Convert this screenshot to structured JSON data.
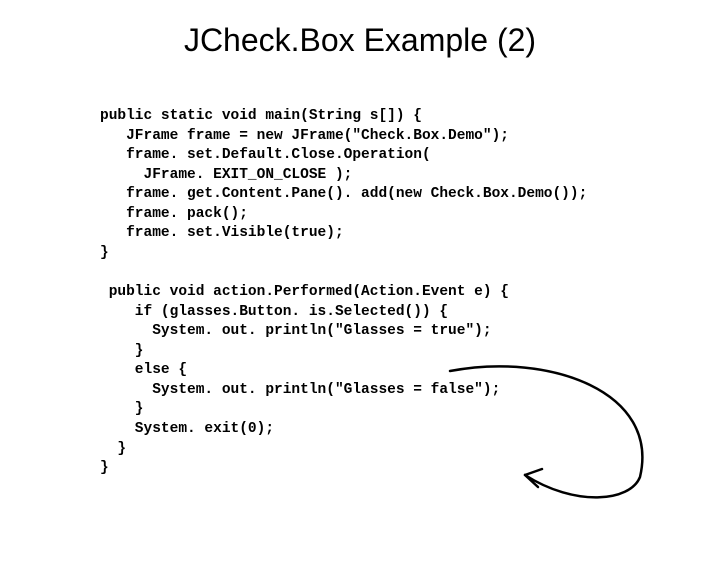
{
  "title": "JCheck.Box Example (2)",
  "code_lines": [
    "public static void main(String s[]) {",
    "   JFrame frame = new JFrame(\"Check.Box.Demo\");",
    "   frame. set.Default.Close.Operation(",
    "     JFrame. EXIT_ON_CLOSE );",
    "   frame. get.Content.Pane(). add(new Check.Box.Demo());",
    "   frame. pack();",
    "   frame. set.Visible(true);",
    "}",
    "",
    " public void action.Performed(Action.Event e) {",
    "    if (glasses.Button. is.Selected()) {",
    "      System. out. println(\"Glasses = true\");",
    "    }",
    "    else {",
    "      System. out. println(\"Glasses = false\");",
    "    }",
    "    System. exit(0);",
    "  }",
    "}"
  ]
}
